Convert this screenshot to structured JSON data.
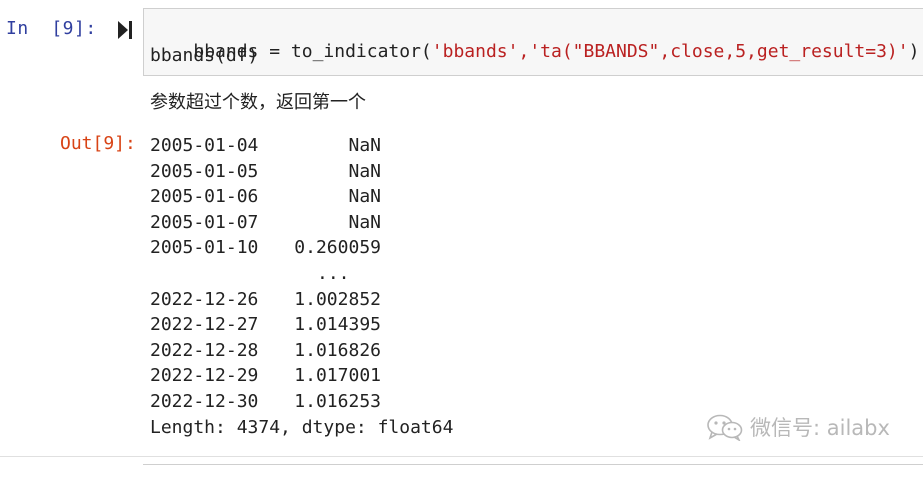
{
  "input_cell": {
    "prompt": "In  [9]:",
    "code_line1_var": "bbands = to_indicator(",
    "code_line1_str": "'bbands','ta(\"BBANDS\",close,5,get_result=3)'",
    "code_line1_close": ")",
    "code_line2": "bbands(df)"
  },
  "markdown_note": "参数超过个数，返回第一个",
  "output_cell": {
    "prompt": "Out[9]:",
    "rows": [
      {
        "date": "2005-01-04",
        "value": "NaN"
      },
      {
        "date": "2005-01-05",
        "value": "NaN"
      },
      {
        "date": "2005-01-06",
        "value": "NaN"
      },
      {
        "date": "2005-01-07",
        "value": "NaN"
      },
      {
        "date": "2005-01-10",
        "value": "0.260059"
      },
      {
        "ellipsis": "..."
      },
      {
        "date": "2022-12-26",
        "value": "1.002852"
      },
      {
        "date": "2022-12-27",
        "value": "1.014395"
      },
      {
        "date": "2022-12-28",
        "value": "1.016826"
      },
      {
        "date": "2022-12-29",
        "value": "1.017001"
      },
      {
        "date": "2022-12-30",
        "value": "1.016253"
      }
    ],
    "footer": "Length: 4374, dtype: float64"
  },
  "watermark": {
    "text": "微信号: ailabx",
    "icon": "wechat-icon"
  },
  "colors": {
    "in_prompt": "#303f9f",
    "out_prompt": "#d84315",
    "string": "#ba2121",
    "cell_bg": "#f7f7f7",
    "cell_border": "#cfcfcf",
    "watermark": "#b8b8b8"
  }
}
